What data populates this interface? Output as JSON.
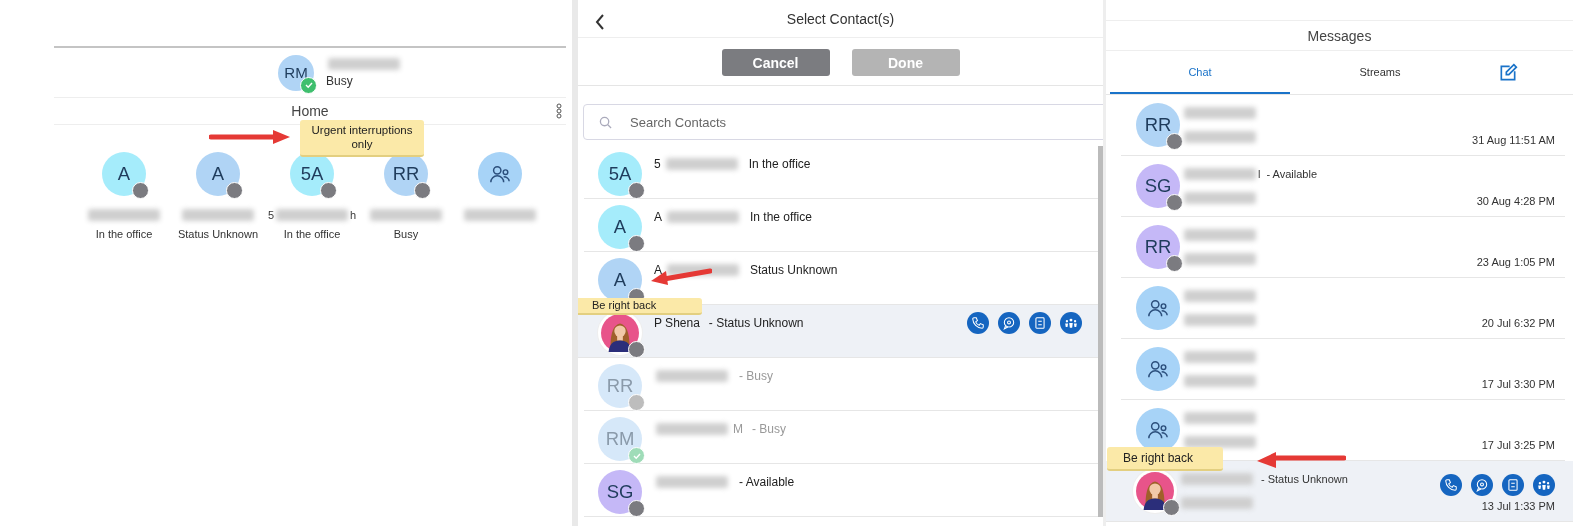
{
  "home_panel": {
    "header": {
      "kind": "initials",
      "initials": "RM",
      "color": "#b0d4f5",
      "available": true,
      "name": [
        {
          "kind": "blur"
        }
      ],
      "status_text": "Busy"
    },
    "section_title": "Home",
    "tooltip": "Urgent interruptions only",
    "favorites": [
      {
        "kind": "initials",
        "initials": "A",
        "color": "#a5ecfb",
        "available": false,
        "name": [
          {
            "kind": "blur"
          }
        ],
        "status_text": "In the office"
      },
      {
        "kind": "initials",
        "initials": "A",
        "color": "#b0d4f5",
        "available": false,
        "name": [
          {
            "kind": "blur"
          }
        ],
        "status_text": "Status Unknown"
      },
      {
        "kind": "initials",
        "initials": "5A",
        "color": "#a5ecfb",
        "available": false,
        "name": [
          {
            "kind": "text",
            "text": "5"
          },
          {
            "kind": "blur"
          },
          {
            "kind": "text",
            "text": "h"
          }
        ],
        "status_text": "In the office"
      },
      {
        "kind": "initials",
        "initials": "RR",
        "color": "#b0d4f5",
        "available": false,
        "name": [
          {
            "kind": "blur"
          }
        ],
        "status_text": "Busy"
      },
      {
        "kind": "group",
        "color": "#a7d3f7",
        "name": [
          {
            "kind": "blur"
          }
        ]
      }
    ]
  },
  "select_panel": {
    "title": "Select Contact(s)",
    "buttons": [
      {
        "label": "Cancel",
        "disabled": false
      },
      {
        "label": "Done",
        "disabled": true
      }
    ],
    "search": {
      "placeholder": "Search Contacts"
    },
    "tooltip": "Be right back",
    "contacts": [
      {
        "kind": "initials",
        "initials": "5A",
        "color": "#a5ecfb",
        "available": false,
        "dimmed": false,
        "selected": false,
        "name": [
          {
            "kind": "text",
            "text": "5"
          },
          {
            "kind": "blur"
          }
        ],
        "status_text": "In the office"
      },
      {
        "kind": "initials",
        "initials": "A",
        "color": "#a5ecfb",
        "available": false,
        "dimmed": false,
        "selected": false,
        "name": [
          {
            "kind": "text",
            "text": "A"
          },
          {
            "kind": "blur"
          }
        ],
        "status_text": "In the office"
      },
      {
        "kind": "initials",
        "initials": "A",
        "color": "#b0d4f5",
        "available": false,
        "dimmed": false,
        "selected": false,
        "name": [
          {
            "kind": "text",
            "text": "A"
          },
          {
            "kind": "blur"
          }
        ],
        "status_text": "Status Unknown"
      },
      {
        "color": "#e8548a",
        "available": false,
        "dimmed": false,
        "selected": true,
        "name": [
          {
            "kind": "text",
            "text": "P Shena"
          }
        ],
        "status_text": "- Status Unknown"
      },
      {
        "kind": "initials",
        "initials": "RR",
        "color": "#d6e8f9",
        "available": false,
        "dimmed": true,
        "selected": false,
        "name": [
          {
            "kind": "blur"
          }
        ],
        "status_text": "- Busy"
      },
      {
        "kind": "initials",
        "initials": "RM",
        "color": "#d6e8f9",
        "available": true,
        "dimmed": true,
        "selected": false,
        "name": [
          {
            "kind": "blur"
          },
          {
            "kind": "text",
            "text": "M"
          }
        ],
        "status_text": "- Busy"
      },
      {
        "kind": "initials",
        "initials": "SG",
        "color": "#c5b8f7",
        "available": false,
        "dimmed": false,
        "selected": false,
        "name": [
          {
            "kind": "blur"
          }
        ],
        "status_text": "- Available"
      }
    ]
  },
  "messages_panel": {
    "title": "Messages",
    "tabs": [
      {
        "label": "Chat",
        "selected": true
      },
      {
        "label": "Streams",
        "selected": false
      }
    ],
    "tooltip": "Be right back",
    "chats": [
      {
        "kind": "initials",
        "initials": "RR",
        "color": "#b0d4f5",
        "available": false,
        "selected": false,
        "name": [
          {
            "kind": "blur"
          }
        ],
        "preview": [
          {
            "kind": "blur"
          }
        ],
        "time": "31 Aug 11:51 AM"
      },
      {
        "kind": "initials",
        "initials": "SG",
        "color": "#c5b8f7",
        "available": false,
        "selected": false,
        "name": [
          {
            "kind": "blur"
          },
          {
            "kind": "text",
            "text": "l"
          }
        ],
        "status_text": "- Available",
        "preview": [
          {
            "kind": "blur"
          }
        ],
        "time": "30 Aug 4:28 PM"
      },
      {
        "kind": "initials",
        "initials": "RR",
        "color": "#c5b8f7",
        "available": false,
        "selected": false,
        "name": [
          {
            "kind": "blur"
          }
        ],
        "preview": [
          {
            "kind": "blur"
          }
        ],
        "time": "23 Aug 1:05 PM"
      },
      {
        "kind": "group",
        "color": "#a7d3f7",
        "selected": false,
        "name": [
          {
            "kind": "blur"
          }
        ],
        "preview": [
          {
            "kind": "blur"
          }
        ],
        "time": "20 Jul 6:32 PM"
      },
      {
        "kind": "group",
        "color": "#a7d3f7",
        "selected": false,
        "name": [
          {
            "kind": "blur"
          }
        ],
        "preview": [
          {
            "kind": "blur"
          }
        ],
        "time": "17 Jul 3:30 PM"
      },
      {
        "kind": "group",
        "color": "#a7d3f7",
        "selected": false,
        "name": [
          {
            "kind": "blur"
          }
        ],
        "preview": [
          {
            "kind": "blur"
          }
        ],
        "time": "17 Jul 3:25 PM"
      },
      {
        "color": "#e8548a",
        "available": false,
        "selected": true,
        "name": [
          {
            "kind": "blur"
          }
        ],
        "status_text": "- Status Unknown",
        "preview": [
          {
            "kind": "blur"
          }
        ],
        "time": "13 Jul 1:33 PM"
      }
    ]
  }
}
